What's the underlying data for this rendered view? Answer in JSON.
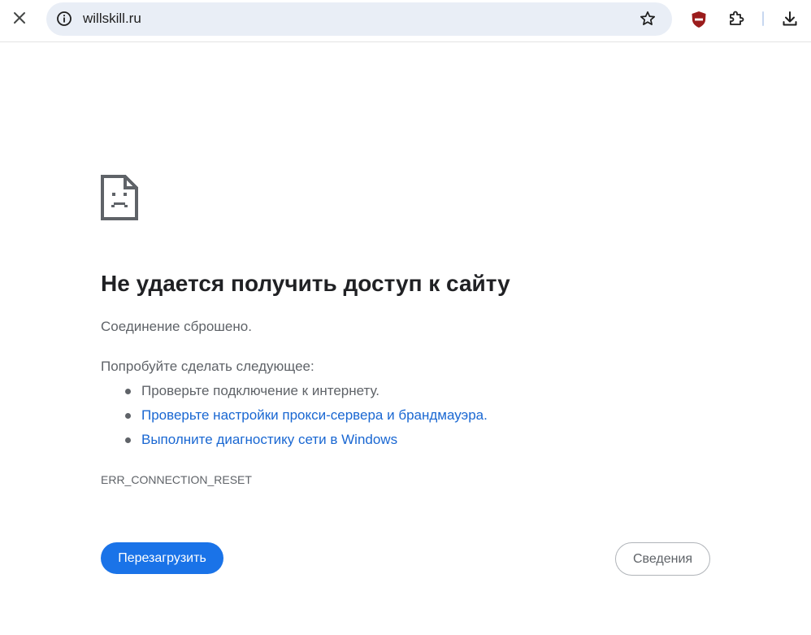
{
  "toolbar": {
    "url": "willskill.ru",
    "icons": {
      "close": "close-icon",
      "info": "info-icon",
      "star": "star-icon",
      "shield": "shield-icon",
      "extensions": "puzzle-icon",
      "download": "download-icon"
    }
  },
  "error": {
    "heading": "Не удается получить доступ к сайту",
    "description": "Соединение сброшено.",
    "suggestions_title": "Попробуйте сделать следующее:",
    "suggestions": [
      {
        "text": "Проверьте подключение к интернету.",
        "link": false
      },
      {
        "text": "Проверьте настройки прокси-сервера и брандмауэра.",
        "link": true
      },
      {
        "text": "Выполните диагностику сети в Windows",
        "link": true
      }
    ],
    "code": "ERR_CONNECTION_RESET"
  },
  "buttons": {
    "reload": "Перезагрузить",
    "details": "Сведения"
  },
  "colors": {
    "accent": "#1a73e8",
    "link": "#1967d2",
    "omnibox_bg": "#e9eef6",
    "shield": "#9b1c1c"
  }
}
